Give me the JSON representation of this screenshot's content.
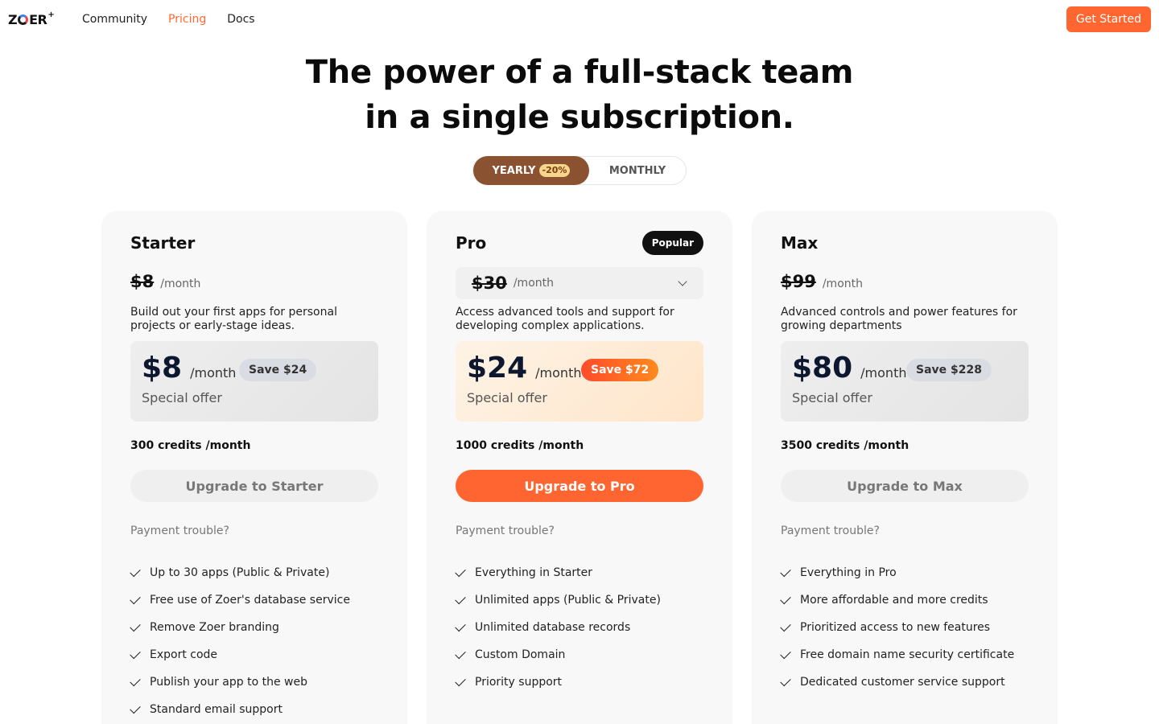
{
  "header": {
    "logo": "ZOER",
    "logo_plus": "+",
    "nav": [
      {
        "label": "Community"
      },
      {
        "label": "Pricing"
      },
      {
        "label": "Docs"
      }
    ],
    "cta_label": "Get Started",
    "colors": {
      "accent": "#ff6630",
      "active_nav": "#ff6a30"
    }
  },
  "hero": {
    "line1": "The power of a full-stack team",
    "line2": "in a single subscription."
  },
  "billing_toggle": {
    "yearly_label": "YEARLY",
    "yearly_badge": "-20%",
    "monthly_label": "MONTHLY",
    "selected": "YEARLY"
  },
  "plans": [
    {
      "name": "Starter",
      "original_price": "$8",
      "per": "/month",
      "description": "Build out your first apps for personal projects or early-stage ideas.",
      "offer_price": "$8",
      "offer_per": "/month",
      "save": "Save $24",
      "offer_label": "Special offer",
      "credits": "300 credits /month",
      "upgrade_label": "Upgrade to Starter",
      "trouble": "Payment trouble?",
      "features": [
        "Up to 30 apps (Public & Private)",
        "Free use of Zoer's database service",
        "Remove Zoer branding",
        "Export code",
        "Publish your app to the web",
        "Standard email support"
      ]
    },
    {
      "name": "Pro",
      "badge": "Popular",
      "original_price": "$30",
      "per": "/month",
      "description": "Access advanced tools and support for developing complex applications.",
      "offer_price": "$24",
      "offer_per": "/month",
      "save": "Save $72",
      "offer_label": "Special offer",
      "credits": "1000 credits /month",
      "upgrade_label": "Upgrade to Pro",
      "trouble": "Payment trouble?",
      "features": [
        "Everything in Starter",
        "Unlimited apps (Public & Private)",
        "Unlimited database records",
        "Custom Domain",
        "Priority support"
      ]
    },
    {
      "name": "Max",
      "original_price": "$99",
      "per": "/month",
      "description": "Advanced controls and power features for growing departments",
      "offer_price": "$80",
      "offer_per": "/month",
      "save": "Save $228",
      "offer_label": "Special offer",
      "credits": "3500 credits /month",
      "upgrade_label": "Upgrade to Max",
      "trouble": "Payment trouble?",
      "features": [
        "Everything in Pro",
        "More affordable and more credits",
        "Prioritized access to new features",
        "Free domain name security certificate",
        "Dedicated customer service support"
      ]
    }
  ]
}
